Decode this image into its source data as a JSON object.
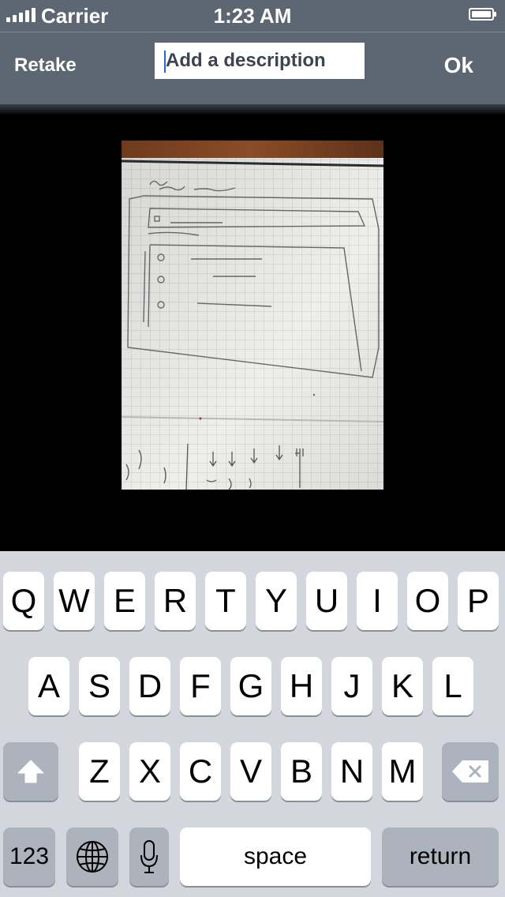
{
  "status_bar": {
    "carrier": "Carrier",
    "time": "1:23 AM"
  },
  "nav": {
    "retake_label": "Retake",
    "ok_label": "Ok",
    "description_placeholder": "Add a description",
    "description_value": ""
  },
  "keyboard": {
    "row1": [
      "Q",
      "W",
      "E",
      "R",
      "T",
      "Y",
      "U",
      "I",
      "O",
      "P"
    ],
    "row2": [
      "A",
      "S",
      "D",
      "F",
      "G",
      "H",
      "J",
      "K",
      "L"
    ],
    "row3": [
      "Z",
      "X",
      "C",
      "V",
      "B",
      "N",
      "M"
    ],
    "numbers_label": "123",
    "space_label": "space",
    "return_label": "return",
    "icons": {
      "shift": "shift-icon",
      "delete": "delete-icon",
      "globe": "globe-icon",
      "mic": "microphone-icon"
    }
  }
}
